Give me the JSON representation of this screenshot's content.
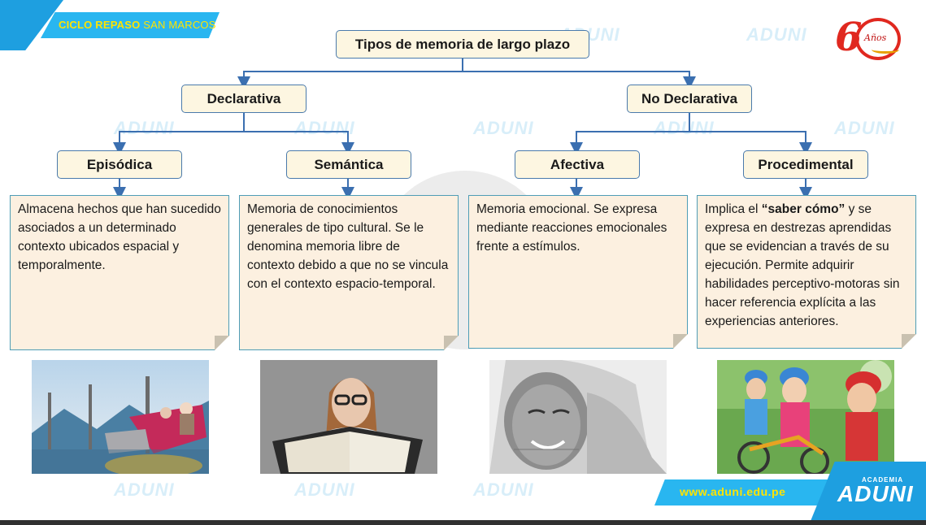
{
  "header": {
    "banner_bold": "CICLO REPASO",
    "banner_light": "SAN MARCOS",
    "logo_digit": "6",
    "logo_word": "Años"
  },
  "watermark": {
    "text": "ADUNI",
    "small": "ACADEMIA"
  },
  "diagram": {
    "root": "Tipos de memoria de largo plazo",
    "branches": [
      {
        "label": "Declarativa"
      },
      {
        "label": "No Declarativa"
      }
    ],
    "leaves": [
      {
        "label": "Episódica",
        "description": "Almacena hechos que han sucedido asociados a un determinado contexto ubicados espacial y temporalmente.",
        "image": "amusement-park-ride-photo"
      },
      {
        "label": "Semántica",
        "description": "Memoria de conocimientos generales de tipo cultural. Se le denomina memoria libre de contexto debido a que no se vincula con el contexto espacio-temporal.",
        "image": "woman-reading-book-photo"
      },
      {
        "label": "Afectiva",
        "description": "Memoria emocional. Se expresa mediante reacciones emocionales frente a estímulos.",
        "image": "smiling-elderly-woman-photo"
      },
      {
        "label": "Procedimental",
        "description_pre": "Implica el ",
        "description_bold": "“saber cómo”",
        "description_post": " y se expresa en destrezas aprendidas que se evidencian a través de su ejecución. Permite adquirir habilidades perceptivo-motoras sin hacer referencia explícita a las experiencias anteriores.",
        "image": "children-riding-bicycles-photo"
      }
    ]
  },
  "footer": {
    "url": "www.aduni.edu.pe",
    "brand": "ADUNI",
    "brand_small": "ACADEMIA"
  },
  "colors": {
    "banner": "#29b6f0",
    "banner_text": "#ffe400",
    "box_fill": "#fdf6e1",
    "box_border": "#4a7aab",
    "connector": "#3b6fb0",
    "logo_red": "#e0281f"
  }
}
